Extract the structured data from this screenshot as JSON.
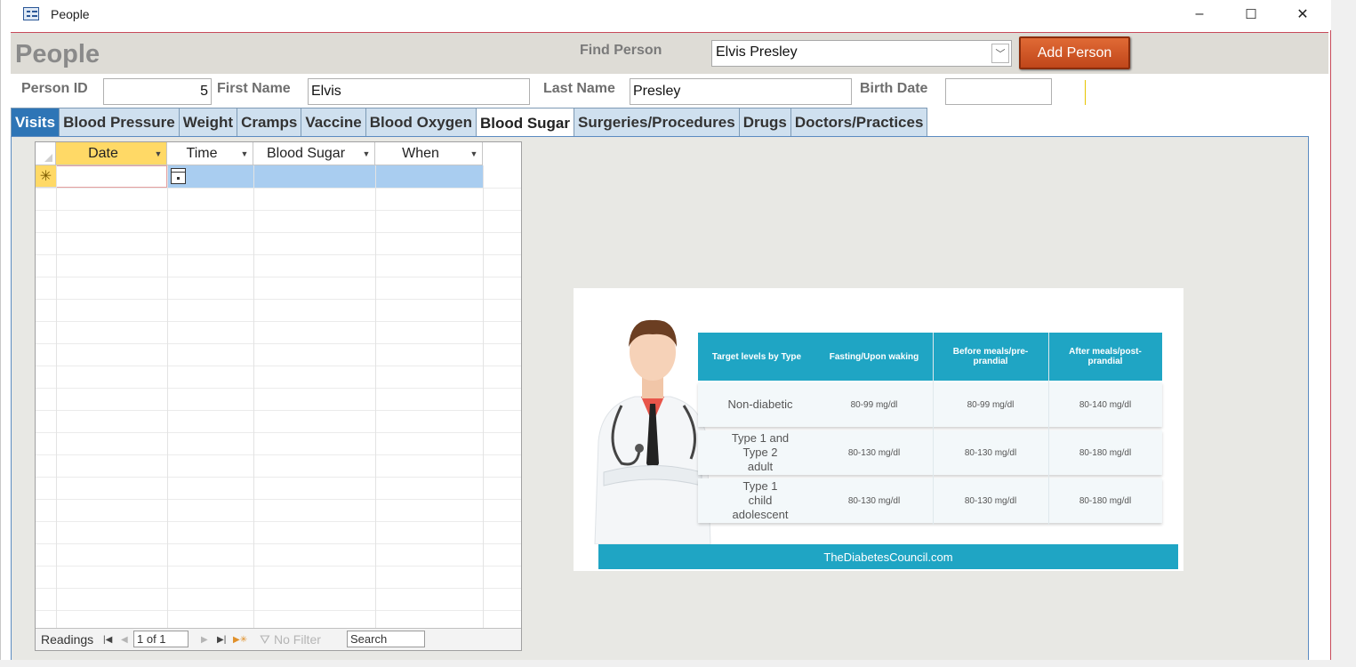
{
  "window": {
    "title": "People",
    "controls": {
      "minimize": "–",
      "maximize": "☐",
      "close": "✕"
    }
  },
  "header": {
    "title": "People",
    "find_label": "Find Person",
    "find_value": "Elvis Presley",
    "add_button": "Add Person"
  },
  "fields": {
    "person_id_label": "Person ID",
    "person_id_value": "5",
    "first_name_label": "First Name",
    "first_name_value": "Elvis",
    "last_name_label": "Last Name",
    "last_name_value": "Presley",
    "birth_date_label": "Birth Date",
    "birth_date_value": ""
  },
  "tabs": [
    "Visits",
    "Blood Pressure",
    "Weight",
    "Cramps",
    "Vaccine",
    "Blood Oxygen",
    "Blood Sugar",
    "Surgeries/Procedures",
    "Drugs",
    "Doctors/Practices"
  ],
  "active_tab": "Blood Sugar",
  "datasheet": {
    "columns": [
      "Date",
      "Time",
      "Blood Sugar",
      "When"
    ],
    "new_record_marker": "✳",
    "nav": {
      "label": "Readings",
      "record": "1 of 1",
      "filter": "No Filter",
      "search": "Search"
    }
  },
  "infographic": {
    "headers": [
      "Target levels by Type",
      "Fasting/Upon waking",
      "Before meals/pre-prandial",
      "After meals/post-prandial"
    ],
    "rows": [
      {
        "label": "Non-diabetic",
        "values": [
          "80-99 mg/dl",
          "80-99 mg/dl",
          "80-140 mg/dl"
        ]
      },
      {
        "label": "Type 1 and Type 2 adult",
        "values": [
          "80-130 mg/dl",
          "80-130 mg/dl",
          "80-180 mg/dl"
        ]
      },
      {
        "label": "Type 1 child adolescent",
        "values": [
          "80-130 mg/dl",
          "80-130 mg/dl",
          "80-180 mg/dl"
        ]
      }
    ],
    "footer": "TheDiabetesCouncil.com"
  },
  "colors": {
    "tab_blue": "#2e75b6",
    "add_button": "#d05428",
    "infographic_teal": "#1fa5c4",
    "selection_yellow": "#ffd966",
    "new_row_blue": "#a9cdf0"
  }
}
